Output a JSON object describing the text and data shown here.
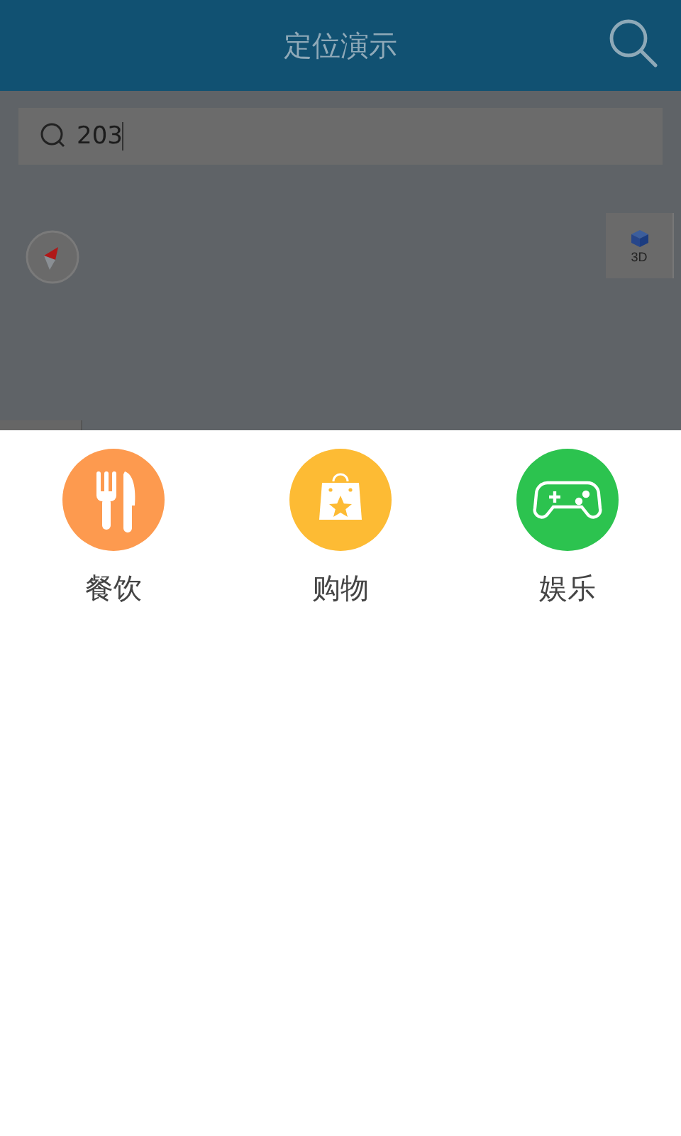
{
  "header": {
    "title": "定位演示"
  },
  "search": {
    "value": "203"
  },
  "map": {
    "button_3d": "3D"
  },
  "categories": [
    {
      "label": "餐饮",
      "kind": "food",
      "color": "#fd9a4f"
    },
    {
      "label": "购物",
      "kind": "shopping",
      "color": "#fdbb34"
    },
    {
      "label": "娱乐",
      "kind": "games",
      "color": "#2cc34f"
    }
  ]
}
